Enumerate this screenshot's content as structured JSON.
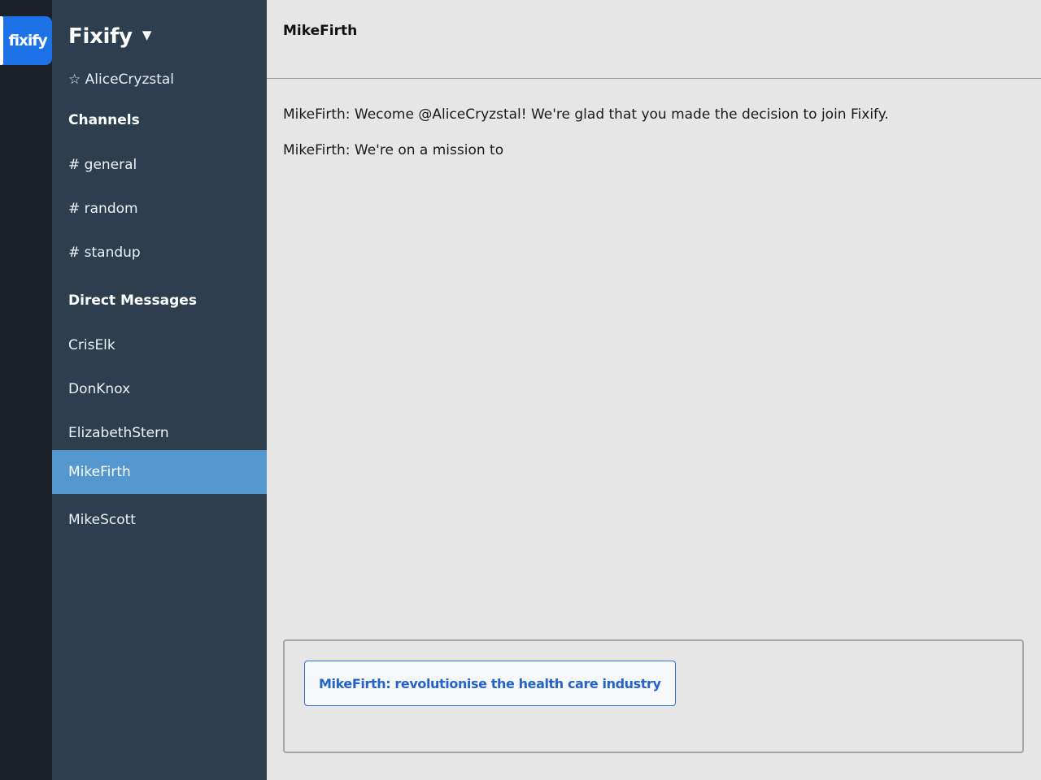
{
  "workspace": {
    "logo_text": "fixify",
    "name": "Fixify",
    "caret": "▼"
  },
  "colors": {
    "rail": "#1a212b",
    "sidebar": "#2d3e4f",
    "active_item": "#5497cf",
    "logo_bg": "#1d72e8",
    "suggestion_text": "#2563cc"
  },
  "sidebar": {
    "current_user": "☆ AliceCryzstal",
    "channels_label": "Channels",
    "channels": [
      {
        "label": "# general"
      },
      {
        "label": "# random"
      },
      {
        "label": "# standup"
      }
    ],
    "dm_label": "Direct Messages",
    "direct_messages": [
      {
        "label": "CrisElk"
      },
      {
        "label": "DonKnox"
      },
      {
        "label": "ElizabethStern"
      },
      {
        "label": "MikeFirth",
        "active": true
      },
      {
        "label": "MikeScott"
      }
    ]
  },
  "chat": {
    "title": "MikeFirth",
    "messages": [
      {
        "text": "MikeFirth: Wecome @AliceCryzstal! We're glad that you made the decision to join Fixify."
      },
      {
        "text": "MikeFirth: We're on a mission to"
      }
    ],
    "suggestion": "MikeFirth: revolutionise the health care industry"
  }
}
